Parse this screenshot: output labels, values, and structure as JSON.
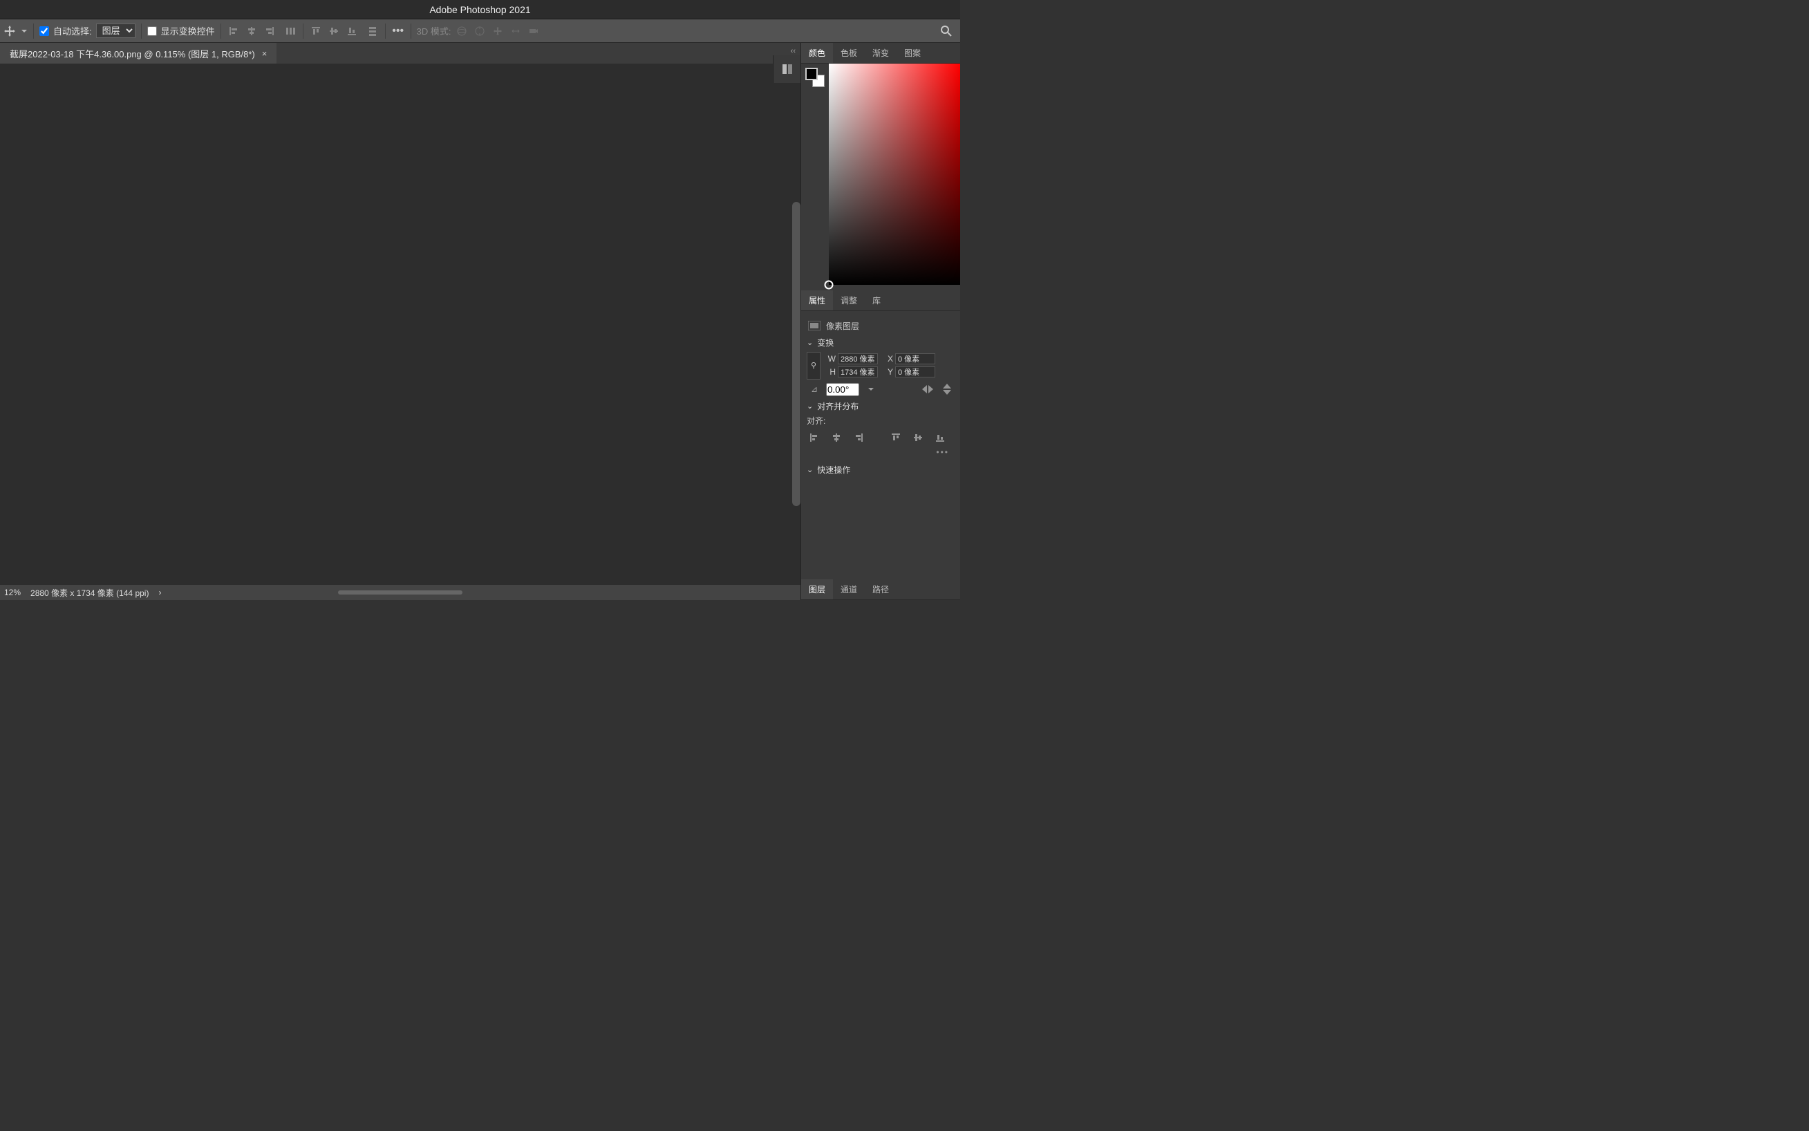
{
  "title": "Adobe Photoshop 2021",
  "optbar": {
    "autoSelectLabel": "自动选择:",
    "autoSelectChecked": true,
    "select_value": "图层",
    "showTransformLabel": "显示变换控件",
    "showTransformChecked": false,
    "mode3dLabel": "3D 模式:"
  },
  "doc_tab": "截屏2022-03-18 下午4.36.00.png @ 0.115% (图层 1, RGB/8*)",
  "collapse_arrow": "‹‹",
  "color_tabs": [
    "颜色",
    "色板",
    "渐变",
    "图案"
  ],
  "prop_tabs": [
    "属性",
    "调整",
    "库"
  ],
  "properties": {
    "layerTypeLabel": "像素图层",
    "transform": {
      "title": "变换",
      "W_label": "W",
      "W": "2880 像素",
      "H_label": "H",
      "H": "1734 像素",
      "X_label": "X",
      "X": "0 像素",
      "Y_label": "Y",
      "Y": "0 像素",
      "angle": "0.00°"
    },
    "align": {
      "title": "对齐并分布",
      "label": "对齐:"
    },
    "quick": {
      "title": "快速操作"
    }
  },
  "layer_tabs": [
    "图层",
    "通道",
    "路径"
  ],
  "status": {
    "zoom": "12%",
    "dims": "2880 像素 x 1734 像素 (144 ppi)",
    "arrow": "›",
    "cross": "×"
  }
}
